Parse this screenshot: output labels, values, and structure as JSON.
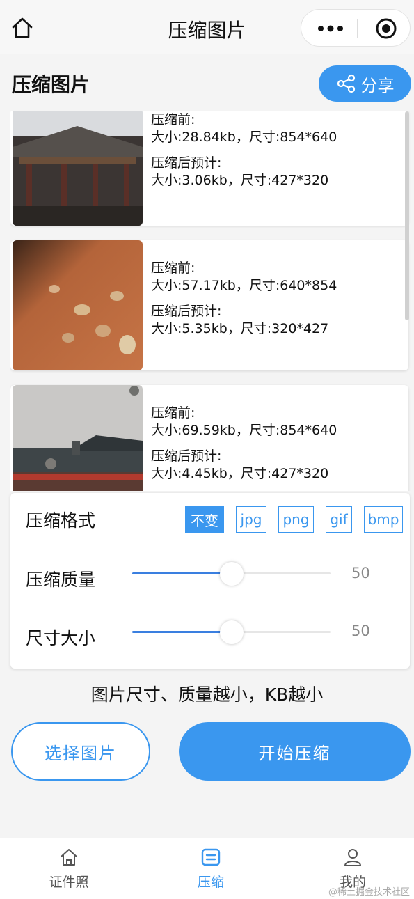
{
  "nav": {
    "title": "压缩图片"
  },
  "page": {
    "heading": "压缩图片",
    "share_label": "分享"
  },
  "images": [
    {
      "before_label": "压缩前:",
      "before_size": "大小:28.84kb，尺寸:854*640",
      "after_label": "压缩后预计:",
      "after_size": "大小:3.06kb，尺寸:427*320"
    },
    {
      "before_label": "压缩前:",
      "before_size": "大小:57.17kb，尺寸:640*854",
      "after_label": "压缩后预计:",
      "after_size": "大小:5.35kb，尺寸:320*427"
    },
    {
      "before_label": "压缩前:",
      "before_size": "大小:69.59kb，尺寸:854*640",
      "after_label": "压缩后预计:",
      "after_size": "大小:4.45kb，尺寸:427*320"
    }
  ],
  "settings": {
    "format_label": "压缩格式",
    "formats": [
      "不变",
      "jpg",
      "png",
      "gif",
      "bmp"
    ],
    "selected_format": "不变",
    "quality_label": "压缩质量",
    "quality_value": "50",
    "size_label": "尺寸大小",
    "size_value": "50",
    "slider_max": 100
  },
  "tip": "图片尺寸、质量越小，KB越小",
  "actions": {
    "select_label": "选择图片",
    "start_label": "开始压缩"
  },
  "tabbar": {
    "items": [
      {
        "label": "证件照",
        "icon": "home-icon"
      },
      {
        "label": "压缩",
        "icon": "compress-icon"
      },
      {
        "label": "我的",
        "icon": "person-icon"
      }
    ],
    "active_index": 1
  },
  "watermark": "@稀土掘金技术社区",
  "colors": {
    "accent": "#3a97ef",
    "background": "#f4f4f4"
  }
}
